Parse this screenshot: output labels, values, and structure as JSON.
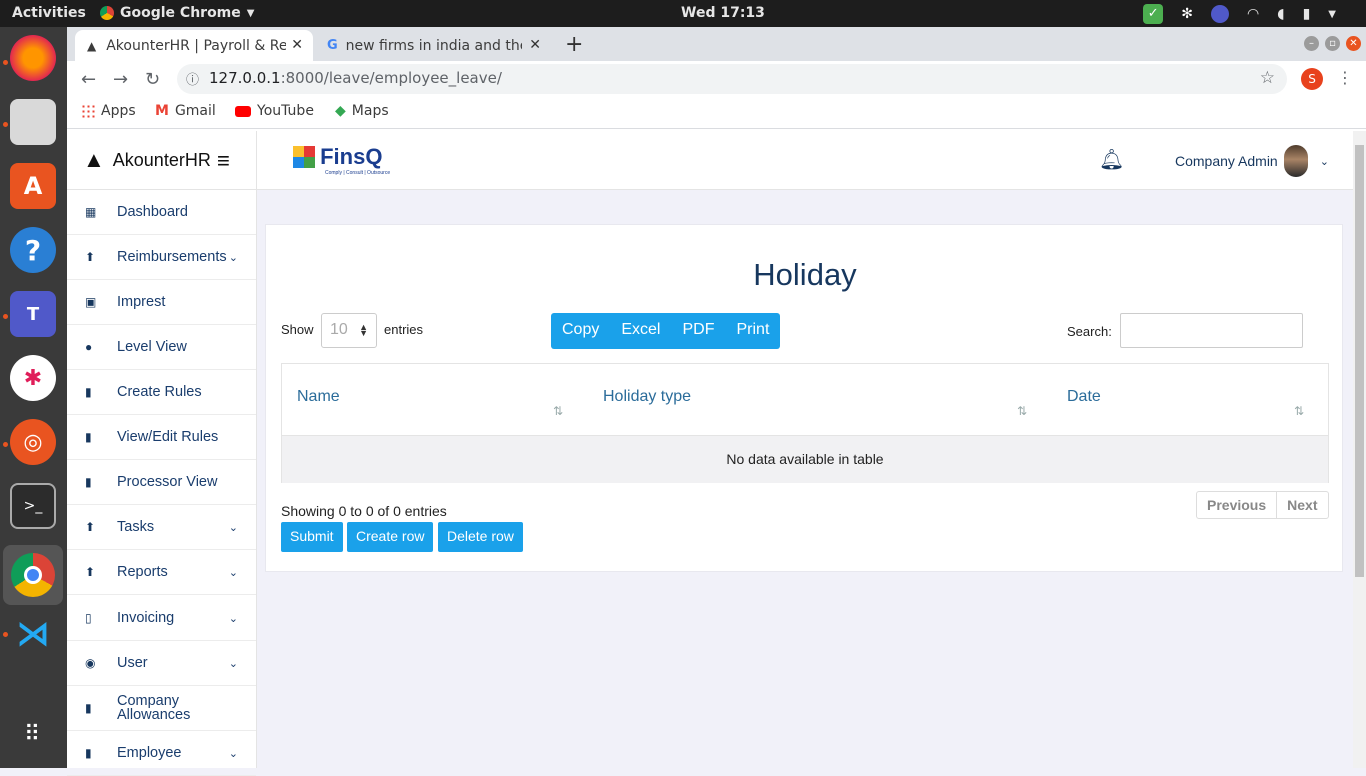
{
  "os": {
    "activities": "Activities",
    "app_name": "Google Chrome",
    "clock": "Wed 17:13"
  },
  "browser": {
    "tabs": [
      {
        "title": "AkounterHR | Payroll & Re"
      },
      {
        "title": "new firms in india and the"
      }
    ],
    "url_host": "127.0.0.1",
    "url_path": ":8000/leave/employee_leave/",
    "profile_initial": "S",
    "bookmarks": [
      "Apps",
      "Gmail",
      "YouTube",
      "Maps"
    ]
  },
  "app": {
    "brand": "AkounterHR",
    "logo_text": "FinsQ",
    "logo_tagline": "Comply | Consult | Outsource",
    "user_name": "Company Admin",
    "menu": [
      {
        "label": "Dashboard",
        "icon": "dashboard-icon",
        "chevron": false
      },
      {
        "label": "Reimbursements",
        "icon": "upload-icon",
        "chevron": true
      },
      {
        "label": "Imprest",
        "icon": "money-icon",
        "chevron": false
      },
      {
        "label": "Level View",
        "icon": "check-circle-icon",
        "chevron": false
      },
      {
        "label": "Create Rules",
        "icon": "book-icon",
        "chevron": false
      },
      {
        "label": "View/Edit Rules",
        "icon": "book-icon",
        "chevron": false
      },
      {
        "label": "Processor View",
        "icon": "book-icon",
        "chevron": false
      },
      {
        "label": "Tasks",
        "icon": "upload-icon",
        "chevron": true
      },
      {
        "label": "Reports",
        "icon": "upload-icon",
        "chevron": true
      },
      {
        "label": "Invoicing",
        "icon": "file-icon",
        "chevron": true
      },
      {
        "label": "User",
        "icon": "user-circle-icon",
        "chevron": true
      },
      {
        "label": "Company Allowances",
        "icon": "book-icon",
        "chevron": false
      },
      {
        "label": "Employee",
        "icon": "book-icon",
        "chevron": true
      }
    ]
  },
  "holiday": {
    "title": "Holiday",
    "show_label": "Show",
    "entries_label": "entries",
    "page_size": "10",
    "export_buttons": [
      "Copy",
      "Excel",
      "PDF",
      "Print"
    ],
    "search_label": "Search:",
    "search_value": "",
    "columns": [
      "Name",
      "Holiday type",
      "Date"
    ],
    "empty_text": "No data available in table",
    "info": "Showing 0 to 0 of 0 entries",
    "prev_label": "Previous",
    "next_label": "Next",
    "submit_label": "Submit",
    "create_row_label": "Create row",
    "delete_row_label": "Delete row"
  },
  "colors": {
    "accent": "#1aa1ea",
    "navy": "#17375e",
    "ubuntu_orange": "#e95420"
  }
}
